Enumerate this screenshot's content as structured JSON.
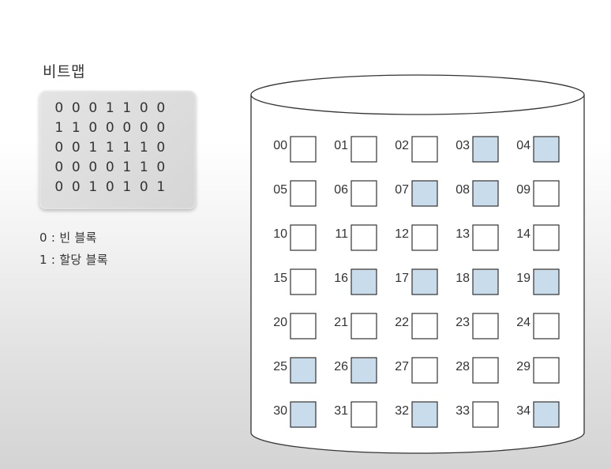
{
  "title": "비트맵",
  "bitmap_rows": [
    [
      "0",
      "0",
      "0",
      "1",
      "1",
      "0",
      "0"
    ],
    [
      "1",
      "1",
      "0",
      "0",
      "0",
      "0",
      "0"
    ],
    [
      "0",
      "0",
      "1",
      "1",
      "1",
      "1",
      "0"
    ],
    [
      "0",
      "0",
      "0",
      "0",
      "1",
      "1",
      "0"
    ],
    [
      "0",
      "0",
      "1",
      "0",
      "1",
      "0",
      "1"
    ]
  ],
  "legend": [
    "0 : 빈 블록",
    "1 : 할당 블록"
  ],
  "blocks": [
    {
      "label": "00",
      "allocated": false
    },
    {
      "label": "01",
      "allocated": false
    },
    {
      "label": "02",
      "allocated": false
    },
    {
      "label": "03",
      "allocated": true
    },
    {
      "label": "04",
      "allocated": true
    },
    {
      "label": "05",
      "allocated": false
    },
    {
      "label": "06",
      "allocated": false
    },
    {
      "label": "07",
      "allocated": true
    },
    {
      "label": "08",
      "allocated": true
    },
    {
      "label": "09",
      "allocated": false
    },
    {
      "label": "10",
      "allocated": false
    },
    {
      "label": "11",
      "allocated": false
    },
    {
      "label": "12",
      "allocated": false
    },
    {
      "label": "13",
      "allocated": false
    },
    {
      "label": "14",
      "allocated": false
    },
    {
      "label": "15",
      "allocated": false
    },
    {
      "label": "16",
      "allocated": true
    },
    {
      "label": "17",
      "allocated": true
    },
    {
      "label": "18",
      "allocated": true
    },
    {
      "label": "19",
      "allocated": true
    },
    {
      "label": "20",
      "allocated": false
    },
    {
      "label": "21",
      "allocated": false
    },
    {
      "label": "22",
      "allocated": false
    },
    {
      "label": "23",
      "allocated": false
    },
    {
      "label": "24",
      "allocated": false
    },
    {
      "label": "25",
      "allocated": true
    },
    {
      "label": "26",
      "allocated": true
    },
    {
      "label": "27",
      "allocated": false
    },
    {
      "label": "28",
      "allocated": false
    },
    {
      "label": "29",
      "allocated": false
    },
    {
      "label": "30",
      "allocated": true
    },
    {
      "label": "31",
      "allocated": false
    },
    {
      "label": "32",
      "allocated": true
    },
    {
      "label": "33",
      "allocated": false
    },
    {
      "label": "34",
      "allocated": true
    }
  ],
  "colors": {
    "allocated_fill": "#c9dcec",
    "empty_fill": "#ffffff",
    "block_stroke": "#333333"
  }
}
